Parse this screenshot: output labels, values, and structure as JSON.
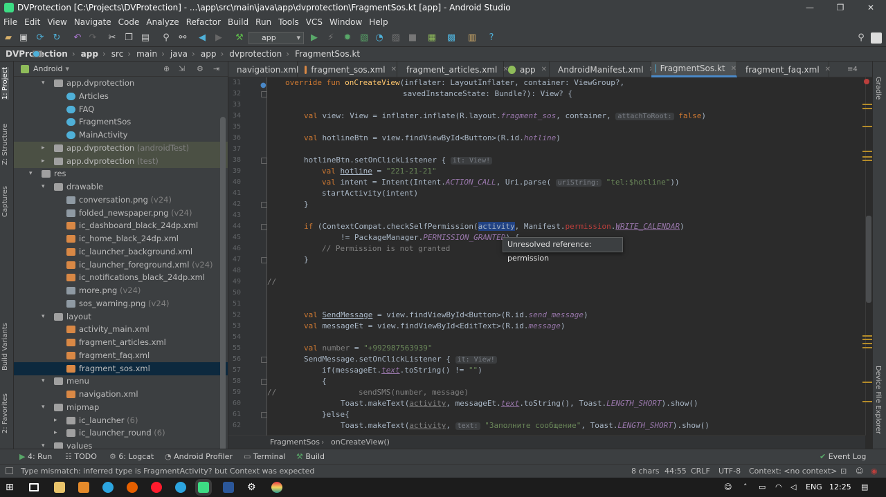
{
  "window": {
    "title": "DVProtection [C:\\Projects\\DVProtection] - ...\\app\\src\\main\\java\\app\\dvprotection\\FragmentSos.kt [app] - Android Studio",
    "minimize": "—",
    "maximize": "❐",
    "close": "✕"
  },
  "menu": [
    "File",
    "Edit",
    "View",
    "Navigate",
    "Code",
    "Analyze",
    "Refactor",
    "Build",
    "Run",
    "Tools",
    "VCS",
    "Window",
    "Help"
  ],
  "toolbar": {
    "run_config": "app"
  },
  "breadcrumb": [
    "DVProtection",
    "app",
    "src",
    "main",
    "java",
    "app",
    "dvprotection",
    "FragmentSos.kt"
  ],
  "left_stripe": {
    "project": "1: Project",
    "structure": "Z: Structure",
    "captures": "Captures",
    "build_variants": "Build Variants",
    "favorites": "2: Favorites"
  },
  "right_stripe": {
    "gradle": "Gradle",
    "device_file_explorer": "Device File Explorer"
  },
  "project_panel": {
    "view": "Android",
    "tree": [
      {
        "label": "app.dvprotection",
        "suffix": ""
      },
      {
        "label": "Articles",
        "suffix": ""
      },
      {
        "label": "FAQ",
        "suffix": ""
      },
      {
        "label": "FragmentSos",
        "suffix": ""
      },
      {
        "label": "MainActivity",
        "suffix": ""
      },
      {
        "label": "app.dvprotection",
        "suffix": "(androidTest)"
      },
      {
        "label": "app.dvprotection",
        "suffix": "(test)"
      },
      {
        "label": "res",
        "suffix": ""
      },
      {
        "label": "drawable",
        "suffix": ""
      },
      {
        "label": "conversation.png",
        "suffix": "(v24)"
      },
      {
        "label": "folded_newspaper.png",
        "suffix": "(v24)"
      },
      {
        "label": "ic_dashboard_black_24dp.xml",
        "suffix": ""
      },
      {
        "label": "ic_home_black_24dp.xml",
        "suffix": ""
      },
      {
        "label": "ic_launcher_background.xml",
        "suffix": ""
      },
      {
        "label": "ic_launcher_foreground.xml",
        "suffix": "(v24)"
      },
      {
        "label": "ic_notifications_black_24dp.xml",
        "suffix": ""
      },
      {
        "label": "more.png",
        "suffix": "(v24)"
      },
      {
        "label": "sos_warning.png",
        "suffix": "(v24)"
      },
      {
        "label": "layout",
        "suffix": ""
      },
      {
        "label": "activity_main.xml",
        "suffix": ""
      },
      {
        "label": "fragment_articles.xml",
        "suffix": ""
      },
      {
        "label": "fragment_faq.xml",
        "suffix": ""
      },
      {
        "label": "fragment_sos.xml",
        "suffix": ""
      },
      {
        "label": "menu",
        "suffix": ""
      },
      {
        "label": "navigation.xml",
        "suffix": ""
      },
      {
        "label": "mipmap",
        "suffix": ""
      },
      {
        "label": "ic_launcher",
        "suffix": "(6)"
      },
      {
        "label": "ic_launcher_round",
        "suffix": "(6)"
      },
      {
        "label": "values",
        "suffix": ""
      }
    ]
  },
  "editor_tabs": [
    "navigation.xml",
    "fragment_sos.xml",
    "fragment_articles.xml",
    "app",
    "AndroidManifest.xml",
    "FragmentSos.kt",
    "fragment_faq.xml"
  ],
  "tab_overflow": "≡4",
  "line_numbers": [
    "31",
    "32",
    "33",
    "34",
    "35",
    "36",
    "37",
    "38",
    "39",
    "40",
    "41",
    "42",
    "43",
    "44",
    "45",
    "46",
    "47",
    "48",
    "49",
    "50",
    "51",
    "52",
    "53",
    "54",
    "55",
    "56",
    "57",
    "58",
    "59",
    "60",
    "61",
    "62"
  ],
  "code": {
    "l31": {
      "a": "override fun ",
      "b": "onCreateView",
      "c": "(inflater: LayoutInflater, container: ViewGroup?,"
    },
    "l32": "savedInstanceState: Bundle?): View? {",
    "l34": {
      "a": "val ",
      "b": "view: View = inflater.inflate(R.layout.",
      "c": "fragment_sos",
      ", d": "",
      "d": ", container, ",
      "e": "attachToRoot:",
      "f": " false",
      ")": ")"
    },
    "l36": {
      "a": "val ",
      "b": "hotlineBtn = view.findViewById<Button>(R.id.",
      "c": "hotline",
      "d": ")"
    },
    "l38": {
      "a": "hotlineBtn.setOnClickListener { ",
      "b": "it: View!"
    },
    "l39": {
      "a": "val ",
      "b": "hotline",
      " c": "",
      "c": " = ",
      "d": "\"221-21-21\""
    },
    "l40": {
      "a": "val ",
      "b": "intent = Intent(Intent.",
      "c": "ACTION_CALL",
      ", d": "",
      "d": ", Uri.parse( ",
      "e": "uriString:",
      "f": " \"tel:$hotline\"",
      "g": "))"
    },
    "l41": "startActivity(intent)",
    "l42": "}",
    "l44": {
      "a": "if ",
      "b": "(ContextCompat.checkSelfPermission(",
      "c": "activity",
      "d": ", Manifest.",
      "e": "permission",
      ".": ".",
      "f": "WRITE_CALENDAR",
      "g": ")"
    },
    "l45": {
      "a": "!= PackageManager.",
      "b": "PERMISSION_GRANTED",
      ") {": ") {"
    },
    "l46": "// Permission is not granted",
    "l47": "}",
    "l49": "//",
    "l52": {
      "a": "val ",
      "b": "SendMessage",
      " = ": " = view.findViewById<Button>(R.id.",
      "c": "send_message",
      "d": ")"
    },
    "l53": {
      "a": "val ",
      "b": "messageEt = view.findViewById<EditText>(R.id.",
      "c": "message",
      "d": ")"
    },
    "l55": {
      "a": "val ",
      "b": "number",
      "c": " = ",
      "d": "\"+992987563939\""
    },
    "l56": {
      "a": "SendMessage.setOnClickListener { ",
      "b": "it: View!"
    },
    "l57": {
      "a": "if(messageEt.",
      "b": "text",
      ".toString() != ": ".toString() != ",
      "c": "\"\"",
      "d": ")"
    },
    "l58": "{",
    "l59": {
      "cm": "//",
      "a": "sendSMS(number, message)"
    },
    "l60": {
      "a": "Toast.makeText(",
      "b": "activity",
      ", messageEt.": ", messageEt.",
      "c": "text",
      ".toString(), Toast.": ".toString(), Toast.",
      "d": "LENGTH_SHORT",
      "e": ").show()"
    },
    "l61": "}else{",
    "l62": {
      "a": "Toast.makeText(",
      "b": "activity",
      ", ": ", ",
      "c": "text:",
      "d": " \"Заполните сообщение\"",
      ", Toast.": ", Toast.",
      "e": "LENGTH_SHORT",
      "f": ").show()"
    }
  },
  "tooltip": "Unresolved reference: permission",
  "editor_breadcrumb": {
    "class": "FragmentSos",
    "method": "onCreateView()"
  },
  "bottom_tabs": {
    "run": "4: Run",
    "todo": "TODO",
    "logcat": "6: Logcat",
    "profiler": "Android Profiler",
    "terminal": "Terminal",
    "build": "Build",
    "event_log": "Event Log"
  },
  "status": {
    "message": "Type mismatch: inferred type is FragmentActivity? but Context was expected",
    "chars": "8 chars",
    "position": "44:55",
    "line_sep": "CRLF",
    "encoding": "UTF-8",
    "context": "Context: <no context>"
  },
  "taskbar": {
    "lang": "ENG",
    "time": "12:25"
  },
  "colors": {
    "accent": "#4a88c7",
    "keyword": "#cc7832",
    "string": "#6a8759",
    "error": "#bc3f3c"
  }
}
